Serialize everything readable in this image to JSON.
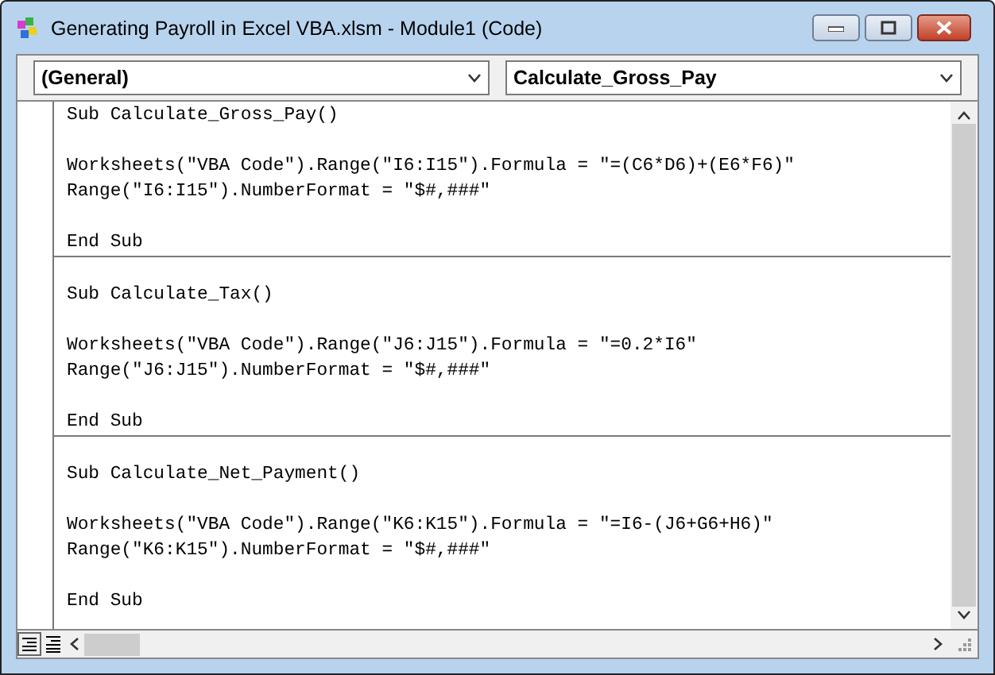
{
  "window": {
    "title": "Generating Payroll in Excel VBA.xlsm - Module1 (Code)"
  },
  "object_box": {
    "value": "(General)"
  },
  "procedure_box": {
    "value": "Calculate_Gross_Pay"
  },
  "procedures": [
    {
      "header": "Sub Calculate_Gross_Pay()",
      "body": [
        "Worksheets(\"VBA Code\").Range(\"I6:I15\").Formula = \"=(C6*D6)+(E6*F6)\"",
        "Range(\"I6:I15\").NumberFormat = \"$#,###\""
      ],
      "footer": "End Sub"
    },
    {
      "header": "Sub Calculate_Tax()",
      "body": [
        "Worksheets(\"VBA Code\").Range(\"J6:J15\").Formula = \"=0.2*I6\"",
        "Range(\"J6:J15\").NumberFormat = \"$#,###\""
      ],
      "footer": "End Sub"
    },
    {
      "header": "Sub Calculate_Net_Payment()",
      "body": [
        "Worksheets(\"VBA Code\").Range(\"K6:K15\").Formula = \"=I6-(J6+G6+H6)\"",
        "Range(\"K6:K15\").NumberFormat = \"$#,###\""
      ],
      "footer": "End Sub"
    }
  ]
}
